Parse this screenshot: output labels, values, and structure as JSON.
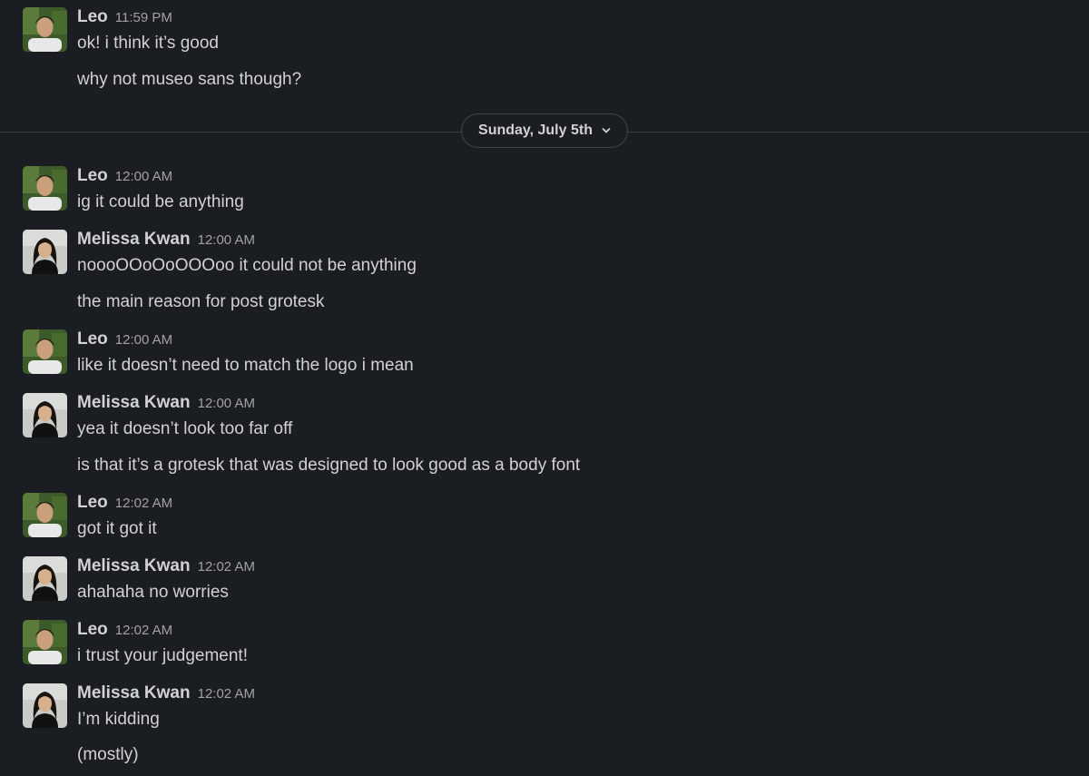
{
  "messages": [
    {
      "sender": "Leo",
      "time": "11:59 PM",
      "lines": [
        "ok! i think it’s good",
        "why not museo sans though?"
      ]
    },
    {
      "sender": "Leo",
      "time": "12:00 AM",
      "lines": [
        "ig it could be anything"
      ]
    },
    {
      "sender": "Melissa Kwan",
      "time": "12:00 AM",
      "lines": [
        "noooOOoOoOOOoo it could not be anything",
        "the main reason for post grotesk"
      ]
    },
    {
      "sender": "Leo",
      "time": "12:00 AM",
      "lines": [
        "like it doesn’t need to match the logo i mean"
      ]
    },
    {
      "sender": "Melissa Kwan",
      "time": "12:00 AM",
      "lines": [
        "yea it doesn’t look too far off",
        "is that it’s a grotesk that was designed to look good as a body font"
      ]
    },
    {
      "sender": "Leo",
      "time": "12:02 AM",
      "lines": [
        "got it got it"
      ]
    },
    {
      "sender": "Melissa Kwan",
      "time": "12:02 AM",
      "lines": [
        "ahahaha no worries"
      ]
    },
    {
      "sender": "Leo",
      "time": "12:02 AM",
      "lines": [
        "i trust your judgement!"
      ]
    },
    {
      "sender": "Melissa Kwan",
      "time": "12:02 AM",
      "lines": [
        "I’m kidding",
        "(mostly)"
      ]
    }
  ],
  "date_divider": {
    "label": "Sunday, July 5th",
    "icon": "chevron-down-icon"
  },
  "colors": {
    "background": "#1a1d21",
    "text": "#d1d2d3",
    "timestamp": "#a1a2a4",
    "divider": "#3a3d42"
  }
}
